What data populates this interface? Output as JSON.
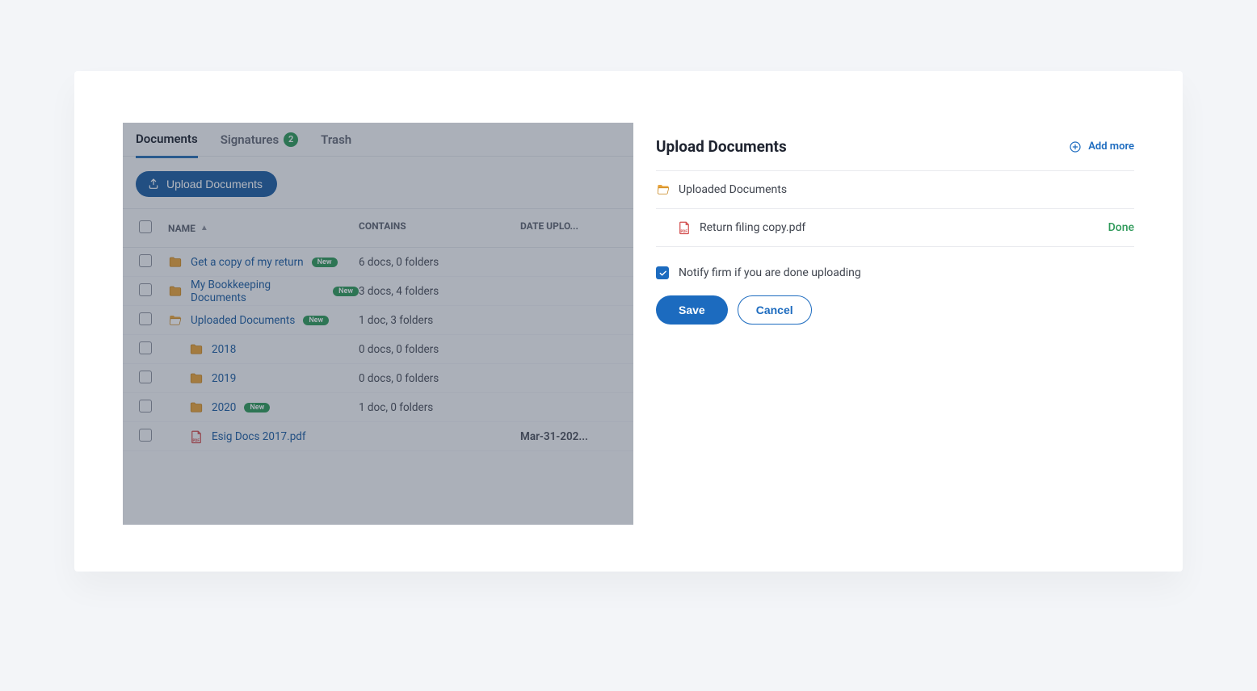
{
  "tabs": {
    "documents": "Documents",
    "signatures": "Signatures",
    "signatures_badge": "2",
    "trash": "Trash"
  },
  "toolbar": {
    "upload_label": "Upload Documents"
  },
  "columns": {
    "name": "NAME",
    "contains": "CONTAINS",
    "date": "DATE UPLO..."
  },
  "rows": [
    {
      "name": "Get a copy of my return",
      "contains": "6 docs, 0 folders",
      "new": true,
      "date": "",
      "indent": false,
      "type": "folder"
    },
    {
      "name": "My Bookkeeping Documents",
      "contains": "3 docs, 4 folders",
      "new": true,
      "date": "",
      "indent": false,
      "type": "folder"
    },
    {
      "name": "Uploaded Documents",
      "contains": "1 doc, 3 folders",
      "new": true,
      "date": "",
      "indent": false,
      "type": "folder-open"
    },
    {
      "name": "2018",
      "contains": "0 docs, 0 folders",
      "new": false,
      "date": "",
      "indent": true,
      "type": "folder"
    },
    {
      "name": "2019",
      "contains": "0 docs, 0 folders",
      "new": false,
      "date": "",
      "indent": true,
      "type": "folder"
    },
    {
      "name": "2020",
      "contains": "1 doc, 0 folders",
      "new": true,
      "date": "",
      "indent": true,
      "type": "folder"
    },
    {
      "name": "Esig Docs 2017.pdf",
      "contains": "",
      "new": false,
      "date": "Mar-31-202...",
      "indent": true,
      "type": "pdf"
    }
  ],
  "panel": {
    "title": "Upload Documents",
    "add_more": "Add more",
    "target_folder": "Uploaded Documents",
    "file_name": "Return filing copy.pdf",
    "file_status": "Done",
    "notify_label": "Notify firm if you are done uploading",
    "save": "Save",
    "cancel": "Cancel"
  },
  "new_pill": "New"
}
